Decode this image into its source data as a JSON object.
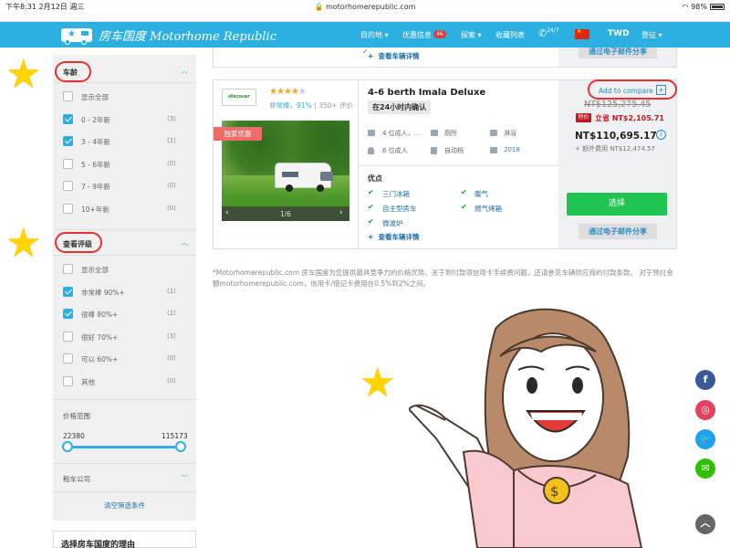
{
  "status": {
    "time": "下午8:31",
    "date": "2月12日 週三",
    "url": "motorhomerepublic.com",
    "battery": "98%"
  },
  "nav": {
    "brand": "房车国度 Motorhome Republic",
    "items": [
      "目的地",
      "优惠信息",
      "探索",
      "收藏列表"
    ],
    "deals_badge": "46",
    "support": "24/7",
    "currency": "TWD",
    "login": "登征"
  },
  "top_card": {
    "link": "查看车辆详情",
    "email_btn": "通过电子邮件分享"
  },
  "filters": {
    "age_title": "车龄",
    "age_options": [
      {
        "label": "显示全部",
        "count": "",
        "checked": false
      },
      {
        "label": "0 - 2年新",
        "count": "(3)",
        "checked": true
      },
      {
        "label": "3 - 4年新",
        "count": "(1)",
        "checked": true
      },
      {
        "label": "5 - 6年新",
        "count": "(0)",
        "checked": false
      },
      {
        "label": "7 - 9年新",
        "count": "(0)",
        "checked": false
      },
      {
        "label": "10+年新",
        "count": "(0)",
        "checked": false
      }
    ],
    "rating_title": "查看评级",
    "rating_options": [
      {
        "label": "显示全部",
        "count": "",
        "checked": false
      },
      {
        "label": "非常棒 90%+",
        "count": "(1)",
        "checked": true
      },
      {
        "label": "很棒 80%+",
        "count": "(2)",
        "checked": true
      },
      {
        "label": "很好 70%+",
        "count": "(3)",
        "checked": false
      },
      {
        "label": "可以 60%+",
        "count": "(0)",
        "checked": false
      },
      {
        "label": "其他",
        "count": "(0)",
        "checked": false
      }
    ],
    "price_title": "价格范围",
    "price_min": "22380",
    "price_max": "115173",
    "company_title": "租车公司",
    "clear": "清空筛选条件",
    "reason_title": "选择房车国度的理由"
  },
  "vehicle": {
    "brand_logo": "discover",
    "rating_text": "非常棒，91%",
    "reviews": "350+ 评价",
    "exclusive": "独家优惠",
    "gallery_index": "1/6",
    "name": "4-6 berth Imala Deluxe",
    "confirm": "在24小时内确认",
    "specs": [
      "4 位成人，...",
      "厕所",
      "淋浴",
      "6 位成人",
      "自动档",
      "2018"
    ],
    "pros_title": "优点",
    "pros": [
      "三门冰箱",
      "暖气",
      "自主型房车",
      "燃气烤箱",
      "微波炉"
    ],
    "details_link": "查看车辆详情",
    "compare": "Add to compare",
    "old_price": "NT$125,275.45",
    "save_tag": "特价",
    "save_text": "立省 NT$2,105.71",
    "price": "NT$110,695.17",
    "extra": "+ 额外费用 NT$12,474.57",
    "select_btn": "选择",
    "email_btn": "通过电子邮件分享"
  },
  "disclaimer": "*Motorhomerepublic.com 房车国度为您提供最具竞争力的价格优势。关于到付款项信用卡手续费问题，还请参见车辆供应商的付款条款。 对于预付金额motorhomerepublic.com，信用卡/借记卡费用在0.5%到2%之间。",
  "social": [
    "facebook-icon",
    "instagram-icon",
    "twitter-icon",
    "wechat-icon"
  ],
  "colors": {
    "brand": "#2bb0e1",
    "green": "#1fc451",
    "red": "#e8302e"
  }
}
